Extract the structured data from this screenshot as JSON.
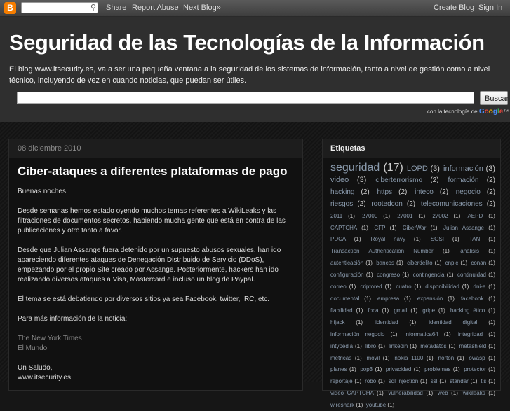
{
  "navbar": {
    "share": "Share",
    "report": "Report Abuse",
    "next": "Next Blog»",
    "create": "Create Blog",
    "signin": "Sign In",
    "logo_letter": "B"
  },
  "header": {
    "title": "Seguridad de las Tecnologías de la Información",
    "description": "El blog www.itsecurity.es, va a ser una pequeña ventana a la seguridad de los sistemas de información, tanto a nivel de gestión como a nivel técnico, incluyendo de vez en cuando noticias, que puedan ser útiles.",
    "search_button": "Buscar",
    "powered_prefix": "con la tecnología de",
    "google": [
      "G",
      "o",
      "o",
      "g",
      "l",
      "e"
    ],
    "tm": "™"
  },
  "post": {
    "date": "08 diciembre 2010",
    "title": "Ciber-ataques a diferentes plataformas de pago",
    "greeting": "Buenas noches,",
    "paragraphs": [
      "Desde semanas hemos estado oyendo muchos temas referentes a WikiLeaks y las filtraciones de documentos secretos, habiendo mucha gente que está en contra de las publicaciones y otro tanto a favor.",
      "Desde que Julian Assange fuera detenido por un supuesto abusos sexuales, han ido apareciendo diferentes ataques de Denegación Distribuido de Servicio (DDoS), empezando por el propio Site creado por Assange. Posteriormente, hackers han ido realizando diversos ataques a Visa, Mastercard e incluso un blog de Paypal.",
      "El tema se está debatiendo por diversos sitios ya sea Facebook, twitter, IRC, etc.",
      "Para más información de la noticia:"
    ],
    "links": [
      "The New York Times",
      "El Mundo"
    ],
    "closing": "Un Saludo,",
    "signature": "www.itsecurity.es"
  },
  "sidebar": {
    "title": "Etiquetas",
    "labels": [
      {
        "name": "seguridad",
        "count": "(17)",
        "size": 16
      },
      {
        "name": "LOPD",
        "count": "(3)",
        "size": 11
      },
      {
        "name": "información",
        "count": "(3)",
        "size": 11
      },
      {
        "name": "video",
        "count": "(3)",
        "size": 11
      },
      {
        "name": "ciberterrorismo",
        "count": "(2)",
        "size": 10
      },
      {
        "name": "formación",
        "count": "(2)",
        "size": 10
      },
      {
        "name": "hacking",
        "count": "(2)",
        "size": 10
      },
      {
        "name": "https",
        "count": "(2)",
        "size": 10
      },
      {
        "name": "inteco",
        "count": "(2)",
        "size": 10
      },
      {
        "name": "negocio",
        "count": "(2)",
        "size": 10
      },
      {
        "name": "riesgos",
        "count": "(2)",
        "size": 10
      },
      {
        "name": "rootedcon",
        "count": "(2)",
        "size": 10
      },
      {
        "name": "telecomunicaciones",
        "count": "(2)",
        "size": 10
      },
      {
        "name": "2011",
        "count": "(1)",
        "size": 8
      },
      {
        "name": "27000",
        "count": "(1)",
        "size": 8
      },
      {
        "name": "27001",
        "count": "(1)",
        "size": 8
      },
      {
        "name": "27002",
        "count": "(1)",
        "size": 8
      },
      {
        "name": "AEPD",
        "count": "(1)",
        "size": 8
      },
      {
        "name": "CAPTCHA",
        "count": "(1)",
        "size": 8
      },
      {
        "name": "CFP",
        "count": "(1)",
        "size": 8
      },
      {
        "name": "CiberWar",
        "count": "(1)",
        "size": 8
      },
      {
        "name": "Julian Assange",
        "count": "(1)",
        "size": 8
      },
      {
        "name": "PDCA",
        "count": "(1)",
        "size": 8
      },
      {
        "name": "Royal navy",
        "count": "(1)",
        "size": 8
      },
      {
        "name": "SGSI",
        "count": "(1)",
        "size": 8
      },
      {
        "name": "TAN",
        "count": "(1)",
        "size": 8
      },
      {
        "name": "Transaction Authentication Number",
        "count": "(1)",
        "size": 8
      },
      {
        "name": "análisis",
        "count": "(1)",
        "size": 8
      },
      {
        "name": "autenticación",
        "count": "(1)",
        "size": 8
      },
      {
        "name": "bancos",
        "count": "(1)",
        "size": 8
      },
      {
        "name": "ciberdelito",
        "count": "(1)",
        "size": 8
      },
      {
        "name": "cnpic",
        "count": "(1)",
        "size": 8
      },
      {
        "name": "conan",
        "count": "(1)",
        "size": 8
      },
      {
        "name": "configuración",
        "count": "(1)",
        "size": 8
      },
      {
        "name": "congreso",
        "count": "(1)",
        "size": 8
      },
      {
        "name": "contingencia",
        "count": "(1)",
        "size": 8
      },
      {
        "name": "continuidad",
        "count": "(1)",
        "size": 8
      },
      {
        "name": "correo",
        "count": "(1)",
        "size": 8
      },
      {
        "name": "criptored",
        "count": "(1)",
        "size": 8
      },
      {
        "name": "cuatro",
        "count": "(1)",
        "size": 8
      },
      {
        "name": "disponibilidad",
        "count": "(1)",
        "size": 8
      },
      {
        "name": "dni-e",
        "count": "(1)",
        "size": 8
      },
      {
        "name": "documental",
        "count": "(1)",
        "size": 8
      },
      {
        "name": "empresa",
        "count": "(1)",
        "size": 8
      },
      {
        "name": "expansión",
        "count": "(1)",
        "size": 8
      },
      {
        "name": "facebook",
        "count": "(1)",
        "size": 8
      },
      {
        "name": "fiabilidad",
        "count": "(1)",
        "size": 8
      },
      {
        "name": "foca",
        "count": "(1)",
        "size": 8
      },
      {
        "name": "gmail",
        "count": "(1)",
        "size": 8
      },
      {
        "name": "gripe",
        "count": "(1)",
        "size": 8
      },
      {
        "name": "hacking ético",
        "count": "(1)",
        "size": 8
      },
      {
        "name": "hijack",
        "count": "(1)",
        "size": 8
      },
      {
        "name": "identidad",
        "count": "(1)",
        "size": 8
      },
      {
        "name": "identidad digital",
        "count": "(1)",
        "size": 8
      },
      {
        "name": "información negocio",
        "count": "(1)",
        "size": 8
      },
      {
        "name": "informatica64",
        "count": "(1)",
        "size": 8
      },
      {
        "name": "integridad",
        "count": "(1)",
        "size": 8
      },
      {
        "name": "intypedia",
        "count": "(1)",
        "size": 8
      },
      {
        "name": "libro",
        "count": "(1)",
        "size": 8
      },
      {
        "name": "linkedin",
        "count": "(1)",
        "size": 8
      },
      {
        "name": "metadatos",
        "count": "(1)",
        "size": 8
      },
      {
        "name": "metashield",
        "count": "(1)",
        "size": 8
      },
      {
        "name": "metricas",
        "count": "(1)",
        "size": 8
      },
      {
        "name": "movil",
        "count": "(1)",
        "size": 8
      },
      {
        "name": "nokia 1100",
        "count": "(1)",
        "size": 8
      },
      {
        "name": "norton",
        "count": "(1)",
        "size": 8
      },
      {
        "name": "owasp",
        "count": "(1)",
        "size": 8
      },
      {
        "name": "planes",
        "count": "(1)",
        "size": 8
      },
      {
        "name": "pop3",
        "count": "(1)",
        "size": 8
      },
      {
        "name": "privacidad",
        "count": "(1)",
        "size": 8
      },
      {
        "name": "problemas",
        "count": "(1)",
        "size": 8
      },
      {
        "name": "protector",
        "count": "(1)",
        "size": 8
      },
      {
        "name": "reportaje",
        "count": "(1)",
        "size": 8
      },
      {
        "name": "robo",
        "count": "(1)",
        "size": 8
      },
      {
        "name": "sql injection",
        "count": "(1)",
        "size": 8
      },
      {
        "name": "ssl",
        "count": "(1)",
        "size": 8
      },
      {
        "name": "standar",
        "count": "(1)",
        "size": 8
      },
      {
        "name": "tls",
        "count": "(1)",
        "size": 8
      },
      {
        "name": "video CAPTCHA",
        "count": "(1)",
        "size": 8
      },
      {
        "name": "vulnerabilidad",
        "count": "(1)",
        "size": 8
      },
      {
        "name": "web",
        "count": "(1)",
        "size": 8
      },
      {
        "name": "wikileaks",
        "count": "(1)",
        "size": 8
      },
      {
        "name": "wireshark",
        "count": "(1)",
        "size": 8
      },
      {
        "name": "youtube",
        "count": "(1)",
        "size": 8
      }
    ]
  }
}
